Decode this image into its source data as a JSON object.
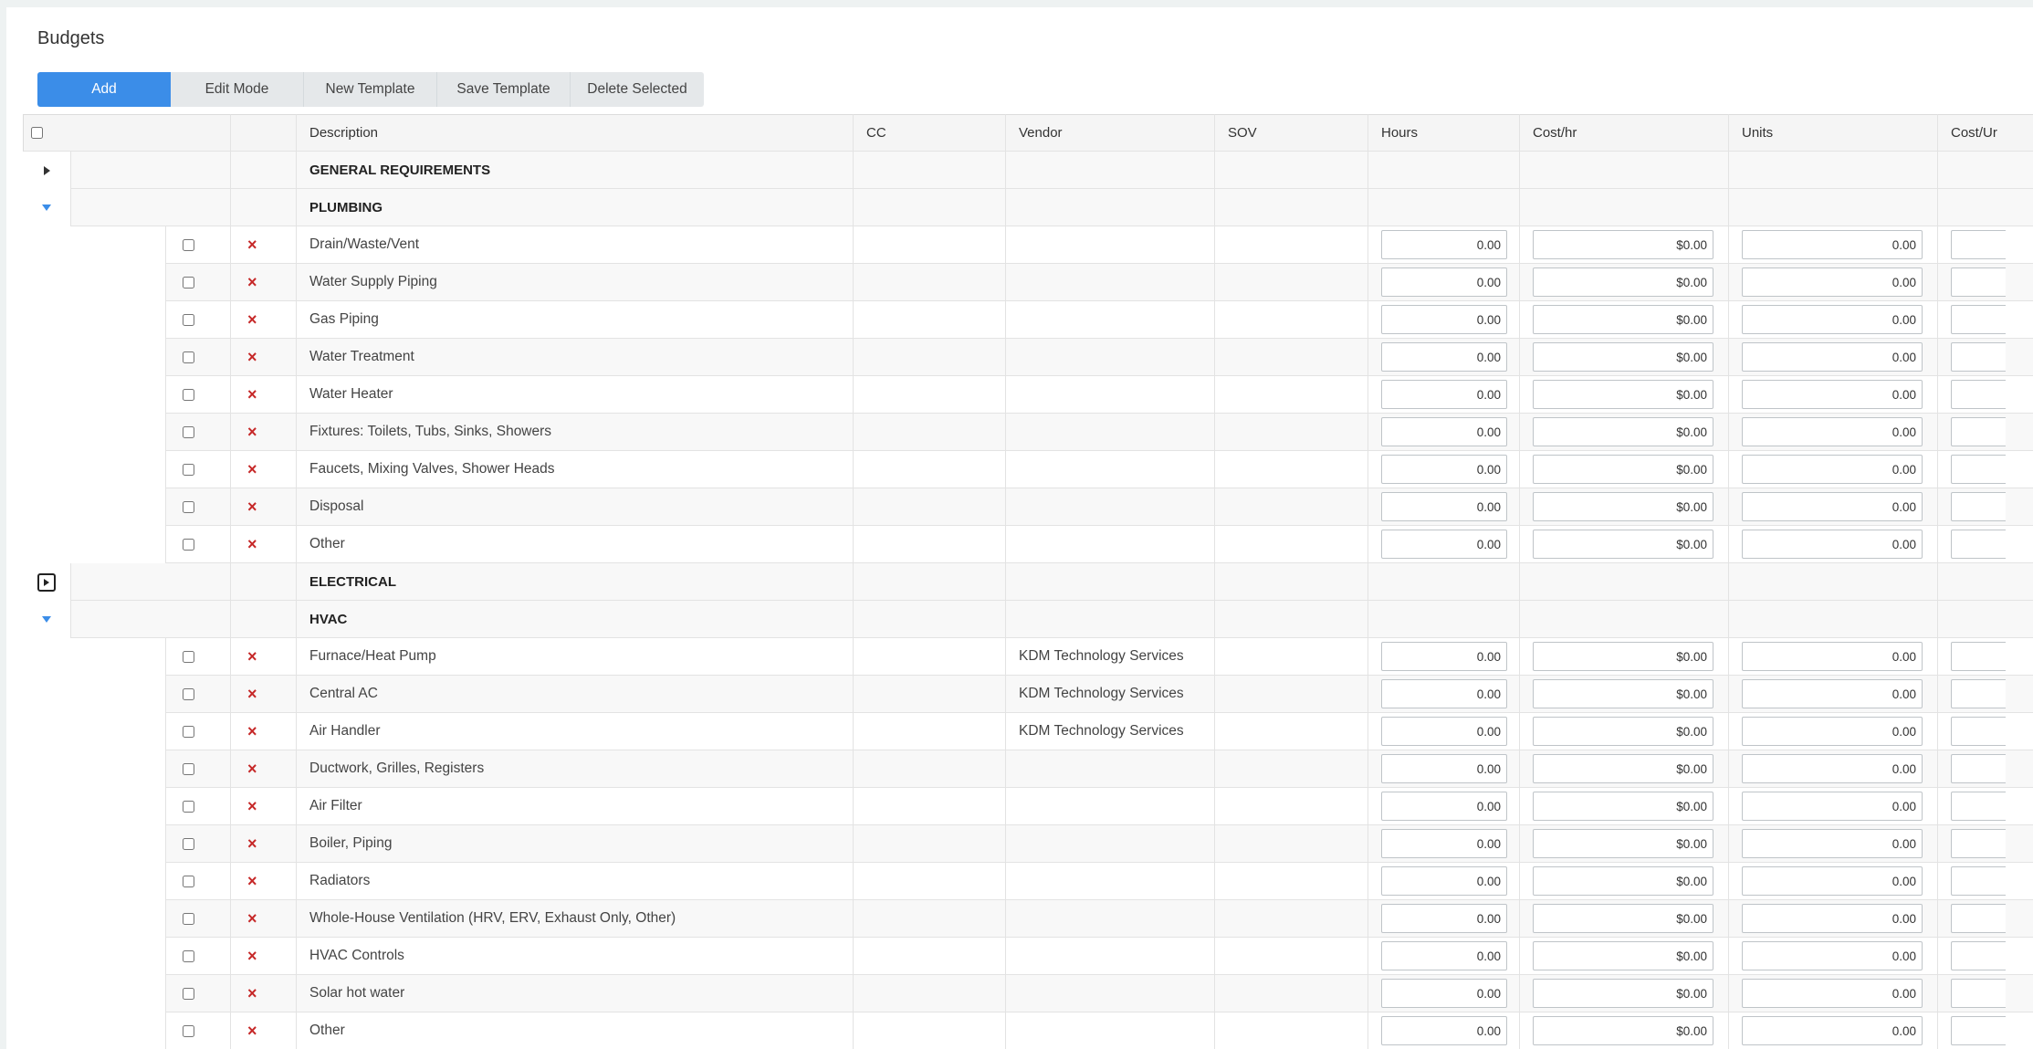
{
  "page": {
    "title": "Budgets"
  },
  "toolbar": {
    "add": "Add",
    "edit_mode": "Edit Mode",
    "new_template": "New Template",
    "save_template": "Save Template",
    "delete_selected": "Delete Selected"
  },
  "columns": {
    "description": "Description",
    "cc": "CC",
    "vendor": "Vendor",
    "sov": "SOV",
    "hours": "Hours",
    "cost_hr": "Cost/hr",
    "units": "Units",
    "cost_unit": "Cost/Ur"
  },
  "groups": [
    {
      "label": "GENERAL REQUIREMENTS",
      "expanded": false,
      "items": []
    },
    {
      "label": "PLUMBING",
      "expanded": true,
      "items": [
        {
          "description": "Drain/Waste/Vent",
          "vendor": "",
          "hours": "0.00",
          "cost_hr": "$0.00",
          "units": "0.00"
        },
        {
          "description": "Water Supply Piping",
          "vendor": "",
          "hours": "0.00",
          "cost_hr": "$0.00",
          "units": "0.00"
        },
        {
          "description": "Gas Piping",
          "vendor": "",
          "hours": "0.00",
          "cost_hr": "$0.00",
          "units": "0.00"
        },
        {
          "description": "Water Treatment",
          "vendor": "",
          "hours": "0.00",
          "cost_hr": "$0.00",
          "units": "0.00"
        },
        {
          "description": "Water Heater",
          "vendor": "",
          "hours": "0.00",
          "cost_hr": "$0.00",
          "units": "0.00"
        },
        {
          "description": "Fixtures: Toilets, Tubs, Sinks, Showers",
          "vendor": "",
          "hours": "0.00",
          "cost_hr": "$0.00",
          "units": "0.00"
        },
        {
          "description": "Faucets, Mixing Valves, Shower Heads",
          "vendor": "",
          "hours": "0.00",
          "cost_hr": "$0.00",
          "units": "0.00"
        },
        {
          "description": "Disposal",
          "vendor": "",
          "hours": "0.00",
          "cost_hr": "$0.00",
          "units": "0.00"
        },
        {
          "description": "Other",
          "vendor": "",
          "hours": "0.00",
          "cost_hr": "$0.00",
          "units": "0.00"
        }
      ]
    },
    {
      "label": "ELECTRICAL",
      "expanded": false,
      "focused": true,
      "items": []
    },
    {
      "label": "HVAC",
      "expanded": true,
      "items": [
        {
          "description": "Furnace/Heat Pump",
          "vendor": "KDM Technology Services",
          "hours": "0.00",
          "cost_hr": "$0.00",
          "units": "0.00"
        },
        {
          "description": "Central AC",
          "vendor": "KDM Technology Services",
          "hours": "0.00",
          "cost_hr": "$0.00",
          "units": "0.00"
        },
        {
          "description": "Air Handler",
          "vendor": "KDM Technology Services",
          "hours": "0.00",
          "cost_hr": "$0.00",
          "units": "0.00"
        },
        {
          "description": "Ductwork, Grilles, Registers",
          "vendor": "",
          "hours": "0.00",
          "cost_hr": "$0.00",
          "units": "0.00"
        },
        {
          "description": "Air Filter",
          "vendor": "",
          "hours": "0.00",
          "cost_hr": "$0.00",
          "units": "0.00"
        },
        {
          "description": "Boiler, Piping",
          "vendor": "",
          "hours": "0.00",
          "cost_hr": "$0.00",
          "units": "0.00"
        },
        {
          "description": "Radiators",
          "vendor": "",
          "hours": "0.00",
          "cost_hr": "$0.00",
          "units": "0.00"
        },
        {
          "description": "Whole-House Ventilation (HRV, ERV, Exhaust Only, Other)",
          "vendor": "",
          "hours": "0.00",
          "cost_hr": "$0.00",
          "units": "0.00"
        },
        {
          "description": "HVAC Controls",
          "vendor": "",
          "hours": "0.00",
          "cost_hr": "$0.00",
          "units": "0.00"
        },
        {
          "description": "Solar hot water",
          "vendor": "",
          "hours": "0.00",
          "cost_hr": "$0.00",
          "units": "0.00"
        },
        {
          "description": "Other",
          "vendor": "",
          "hours": "0.00",
          "cost_hr": "$0.00",
          "units": "0.00"
        }
      ]
    }
  ]
}
